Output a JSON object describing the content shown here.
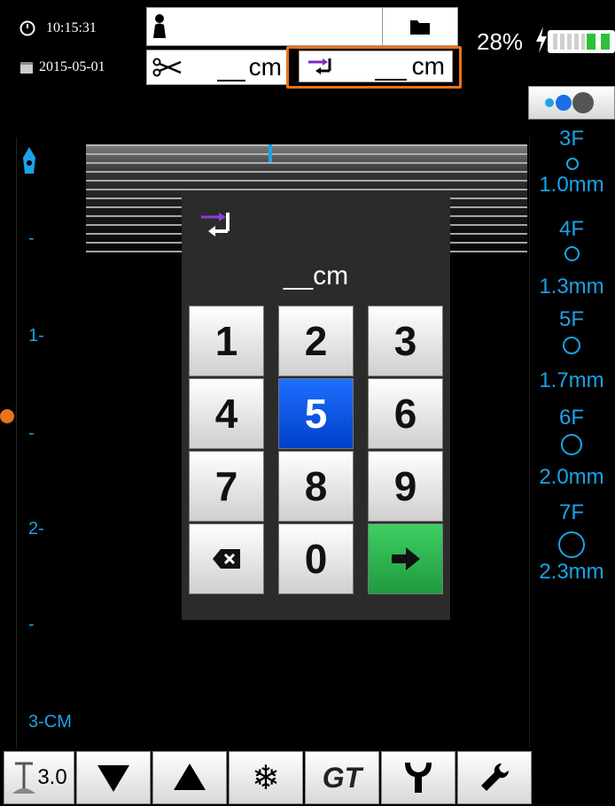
{
  "status": {
    "time": "10:15:31",
    "date": "2015-05-01",
    "battery": "28%",
    "cut_unit": "cm",
    "depth_unit": "cm"
  },
  "depth_scale": {
    "top_marker": "-",
    "labels": [
      "1-",
      "-",
      "2-",
      "-",
      "3-CM"
    ]
  },
  "catheter_sizes": [
    {
      "size": "3F",
      "mm": "1.0mm"
    },
    {
      "size": "4F",
      "mm": "1.3mm"
    },
    {
      "size": "5F",
      "mm": "1.7mm"
    },
    {
      "size": "6F",
      "mm": "2.0mm"
    },
    {
      "size": "7F",
      "mm": "2.3mm"
    }
  ],
  "keypad": {
    "unit_text": "__cm",
    "keys": [
      "1",
      "2",
      "3",
      "4",
      "5",
      "6",
      "7",
      "8",
      "9",
      "0"
    ]
  },
  "toolbar": {
    "depth_value": "3.0",
    "gt_label": "GT"
  },
  "colors": {
    "accent_blue": "#1aa3e8",
    "highlight_orange": "#e8731a",
    "key_active": "#1e6fff",
    "key_enter": "#2bb34f"
  }
}
